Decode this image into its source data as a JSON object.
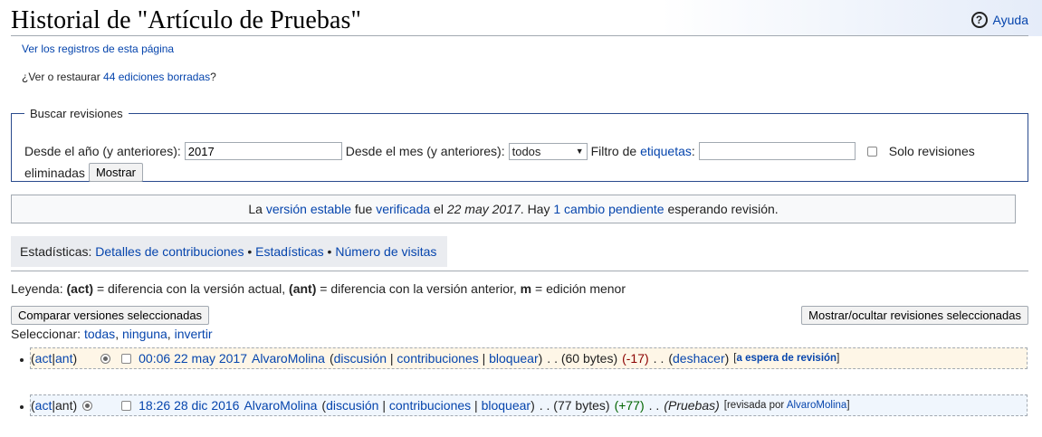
{
  "header": {
    "title": "Historial de \"Artículo de Pruebas\"",
    "help_label": "Ayuda",
    "help_icon": "?"
  },
  "logs_link": "Ver los registros de esta página",
  "deleted": {
    "prefix": "¿Ver o restaurar ",
    "link": "44 ediciones borradas",
    "suffix": "?"
  },
  "search": {
    "legend": "Buscar revisiones",
    "year_label": "Desde el año (y anteriores):",
    "year_value": "2017",
    "month_label": "Desde el mes (y anteriores):",
    "month_value": "todos",
    "tag_label_prefix": "Filtro de ",
    "tag_label_link": "etiquetas",
    "tag_label_suffix": ":",
    "tag_value": "",
    "only_deleted_label_1": "Solo revisiones",
    "only_deleted_label_2": "eliminadas",
    "submit_label": "Mostrar"
  },
  "flagged": {
    "p1": "La ",
    "l1": "versión estable",
    "p2": " fue ",
    "l2": "verificada",
    "p3": " el ",
    "date": "22 may 2017",
    "p4": ". Hay ",
    "l3": "1 cambio pendiente",
    "p5": " esperando revisión."
  },
  "stats": {
    "label": "Estadísticas:",
    "items": [
      "Detalles de contribuciones",
      "Estadísticas",
      "Número de visitas"
    ],
    "sep": " • "
  },
  "legend_line": {
    "prefix": "Leyenda: ",
    "act": "(act)",
    "act_desc": " = diferencia con la versión actual, ",
    "ant": "(ant)",
    "ant_desc": " = diferencia con la versión anterior, ",
    "m": "m",
    "m_desc": " = edición menor"
  },
  "buttons": {
    "compare": "Comparar versiones seleccionadas",
    "hide": "Mostrar/ocultar revisiones seleccionadas"
  },
  "selector": {
    "label": "Seleccionar:",
    "todas": "todas",
    "ninguna": "ninguna",
    "invertir": "invertir",
    "comma": ","
  },
  "revisions": [
    {
      "open": "(",
      "act": "act",
      "sep": " | ",
      "ant": "ant",
      "close": ")",
      "date": "00:06 22 may 2017",
      "user": "AlvaroMolina",
      "talk": "discusión",
      "contribs": "contribuciones",
      "block": "bloquear",
      "size": ". . (60 bytes)",
      "diff": "(-17)",
      "dots": ". .",
      "undo": "deshacer",
      "tag_prefix": "[",
      "tag": "a espera de revisión",
      "tag_suffix": "]"
    },
    {
      "open": "(",
      "act": "act",
      "sep": " | ",
      "ant": "ant",
      "close": ")",
      "date": "18:26 28 dic 2016",
      "user": "AlvaroMolina",
      "talk": "discusión",
      "contribs": "contribuciones",
      "block": "bloquear",
      "size": ". . (77 bytes)",
      "diff": "(+77)",
      "dots": ". .",
      "summary": "(Pruebas)",
      "tag_prefix": "[revisada por ",
      "tag": "AlvaroMolina",
      "tag_suffix": "]"
    }
  ]
}
